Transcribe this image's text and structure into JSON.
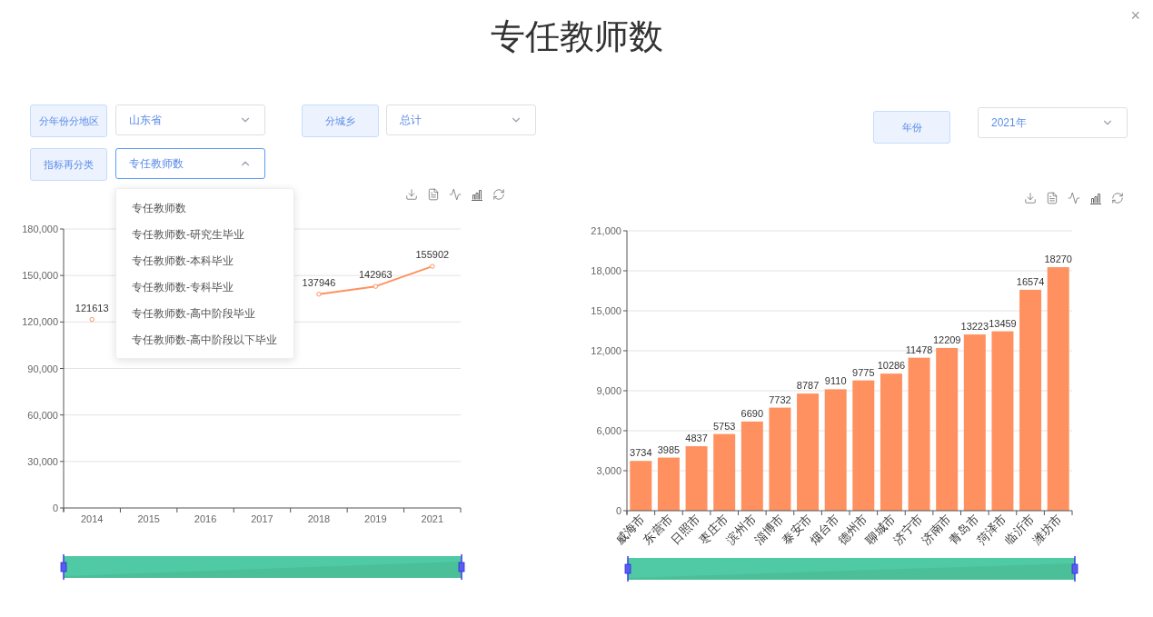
{
  "title": "专任教师数",
  "close": "×",
  "filters": [
    {
      "label": "分年份分地区",
      "value": "山东省",
      "expanded": false
    },
    {
      "label": "分城乡",
      "value": "总计",
      "expanded": false
    },
    {
      "label": "指标再分类",
      "value": "专任教师数",
      "expanded": true,
      "options": [
        "专任教师数",
        "专任教师数-研究生毕业",
        "专任教师数-本科毕业",
        "专任教师数-专科毕业",
        "专任教师数-高中阶段毕业",
        "专任教师数-高中阶段以下毕业"
      ]
    }
  ],
  "year_filter": {
    "label": "年份",
    "value": "2021年",
    "expanded": false
  },
  "line_chart": {
    "chart_data": {
      "type": "line",
      "categories": [
        "2014",
        "2015",
        "2016",
        "2017",
        "2018",
        "2019",
        "2021"
      ],
      "series": [
        {
          "color": "#ff9160",
          "marker": true,
          "values": [
            121613,
            null,
            null,
            null,
            137946,
            142963,
            155902
          ]
        }
      ],
      "grid": true,
      "ylim": [
        0,
        180000
      ],
      "yticks": [
        {
          "value": 0,
          "label": "0"
        },
        {
          "value": 30000,
          "label": "30,000"
        },
        {
          "value": 60000,
          "label": "60,000"
        },
        {
          "value": 90000,
          "label": "90,000"
        },
        {
          "value": 120000,
          "label": "120,000"
        },
        {
          "value": 150000,
          "label": "150,000"
        },
        {
          "value": 180000,
          "label": "180,000"
        }
      ],
      "data_labels": true
    }
  },
  "bar_chart": {
    "chart_data": {
      "type": "bar",
      "categories": [
        "威海市",
        "东营市",
        "日照市",
        "枣庄市",
        "滨州市",
        "淄博市",
        "泰安市",
        "烟台市",
        "德州市",
        "聊城市",
        "济宁市",
        "济南市",
        "青岛市",
        "菏泽市",
        "临沂市",
        "潍坊市"
      ],
      "grid": true,
      "series": [
        {
          "color": "#ff9160",
          "values": [
            3734,
            3985,
            4837,
            5753,
            6690,
            7732,
            8787,
            9110,
            9775,
            10286,
            11478,
            12209,
            13223,
            13459,
            16574,
            18270
          ]
        }
      ],
      "ylim": [
        0,
        21000
      ],
      "yticks": [
        {
          "value": 0,
          "label": "0"
        },
        {
          "value": 3000,
          "label": "3,000"
        },
        {
          "value": 6000,
          "label": "6,000"
        },
        {
          "value": 9000,
          "label": "9,000"
        },
        {
          "value": 12000,
          "label": "12,000"
        },
        {
          "value": 15000,
          "label": "15,000"
        },
        {
          "value": 18000,
          "label": "18,000"
        },
        {
          "value": 21000,
          "label": "21,000"
        }
      ],
      "data_labels": true
    }
  }
}
